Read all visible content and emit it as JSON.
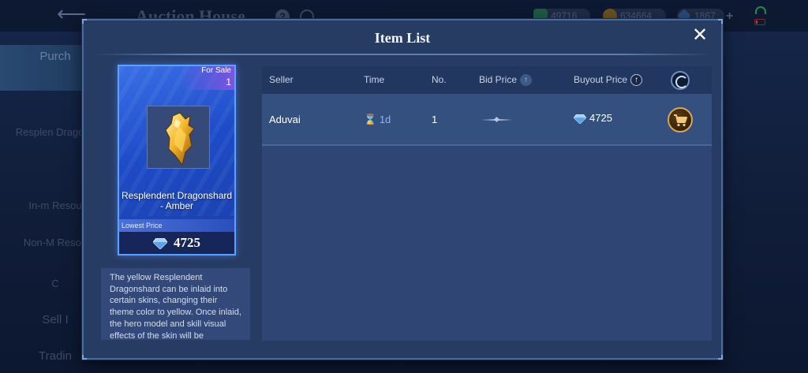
{
  "background": {
    "page_title": "Auction House",
    "help_glyph": "?",
    "currency": [
      {
        "name": "ticket-icon",
        "value": "49716",
        "color": "#2f9a64"
      },
      {
        "name": "gold-coin-icon",
        "value": "634664",
        "color": "#c8962e"
      },
      {
        "name": "diamond-icon",
        "value": "1867",
        "color": "#6fb3ff"
      }
    ],
    "plus_glyph": "+",
    "sidenav": [
      {
        "label": "Purch"
      },
      {
        "label": "Resplen Dragons"
      },
      {
        "label": "In-m Resou"
      },
      {
        "label": "Non-M Resou"
      },
      {
        "label": "C"
      },
      {
        "label": "Sell I"
      },
      {
        "label": "Tradin"
      }
    ]
  },
  "modal": {
    "title": "Item List",
    "close_glyph": "✕"
  },
  "item_card": {
    "for_sale_label": "For Sale",
    "for_sale_count": "1",
    "name": "Resplendent Dragonshard - Amber",
    "lowest_price_label": "Lowest Price",
    "lowest_price": "4725"
  },
  "description": "The yellow Resplendent Dragonshard can be inlaid into certain skins, changing their theme color to yellow. Once inlaid, the hero model and skill visual effects of the skin will be",
  "table": {
    "columns": {
      "seller": "Seller",
      "time": "Time",
      "no": "No.",
      "bid_price": "Bid Price",
      "buyout_price": "Buyout Price"
    },
    "sort_glyph": "↑",
    "rows": [
      {
        "seller": "Aduvai",
        "time": "1d",
        "no": "1",
        "buyout_price": "4725"
      }
    ]
  },
  "colors": {
    "modal_bg": "#273c63",
    "card_blue": "#1d4bc7",
    "accent_gold": "#d8a656",
    "diamond": "#6fb3ff"
  }
}
